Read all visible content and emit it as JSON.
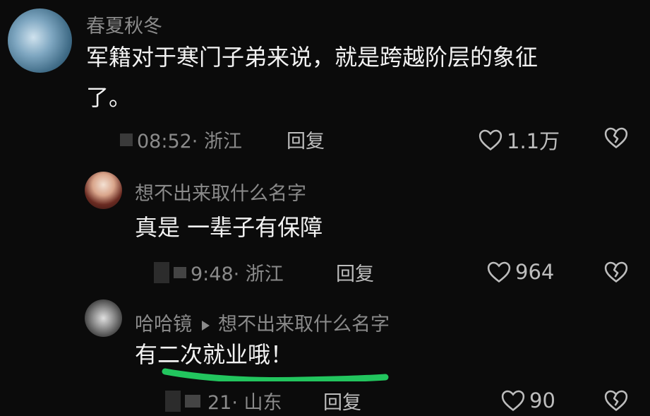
{
  "comment": {
    "username": "春夏秋冬",
    "text_line1": "军籍对于寒门子弟来说，就是跨越阶层的象征",
    "text_line2": "了。",
    "meta": "08:52· 浙江",
    "reply_label": "回复",
    "likes": "1.1万"
  },
  "replies": [
    {
      "username": "想不出来取什么名字",
      "text": "真是 一辈子有保障",
      "meta": "9:48· 浙江",
      "reply_label": "回复",
      "likes": "964"
    },
    {
      "username": "哈哈镜",
      "reply_to": "想不出来取什么名字",
      "text": "有二次就业哦！",
      "meta": "21· 山东",
      "reply_label": "回复",
      "likes": "90"
    }
  ],
  "icons": {
    "like": "heart-outline-icon",
    "dislike": "broken-heart-icon",
    "reply_to": "triangle-right-icon"
  },
  "colors": {
    "background": "#0b0b0b",
    "highlight": "#22c55e"
  }
}
